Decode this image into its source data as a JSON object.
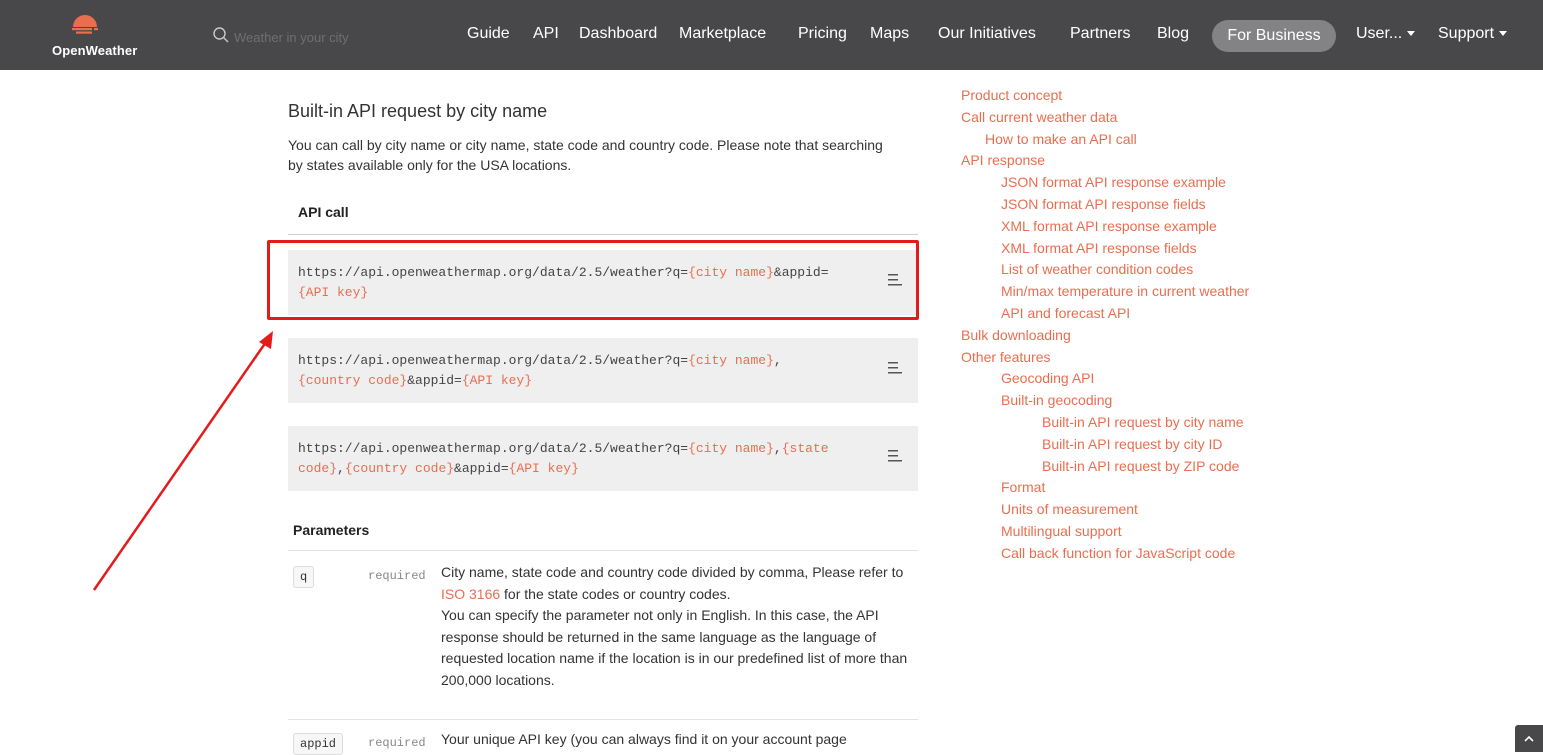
{
  "brand": {
    "name": "OpenWeather",
    "accent": "#e96e50",
    "topbar_bg": "#48484a"
  },
  "search": {
    "placeholder": "Weather in your city"
  },
  "nav": {
    "items": [
      "Guide",
      "API",
      "Dashboard",
      "Marketplace",
      "Pricing",
      "Maps",
      "Our Initiatives",
      "Partners",
      "Blog"
    ],
    "for_business": "For Business",
    "user": "User...",
    "support": "Support"
  },
  "content": {
    "title": "Built-in API request by city name",
    "intro": "You can call by city name or city name, state code and country code. Please note that searching by states available only for the USA locations.",
    "api_call_heading": "API call",
    "code_blocks": [
      [
        {
          "t": "https://api.openweathermap.org/data/2.5/weather?q=",
          "ph": false
        },
        {
          "t": "{city name}",
          "ph": true
        },
        {
          "t": "&appid=",
          "ph": false
        },
        {
          "t": "{API key}",
          "ph": true
        }
      ],
      [
        {
          "t": "https://api.openweathermap.org/data/2.5/weather?q=",
          "ph": false
        },
        {
          "t": "{city name}",
          "ph": true
        },
        {
          "t": ",",
          "ph": false
        },
        {
          "t": "{country code}",
          "ph": true
        },
        {
          "t": "&appid=",
          "ph": false
        },
        {
          "t": "{API key}",
          "ph": true
        }
      ],
      [
        {
          "t": "https://api.openweathermap.org/data/2.5/weather?q=",
          "ph": false
        },
        {
          "t": "{city name}",
          "ph": true
        },
        {
          "t": ",",
          "ph": false
        },
        {
          "t": "{state code}",
          "ph": true
        },
        {
          "t": ",",
          "ph": false
        },
        {
          "t": "{country code}",
          "ph": true
        },
        {
          "t": "&appid=",
          "ph": false
        },
        {
          "t": "{API key}",
          "ph": true
        }
      ]
    ],
    "params_heading": "Parameters",
    "params": [
      {
        "name": "q",
        "req": "required",
        "desc_before": "City name, state code and country code divided by comma, Please refer to ",
        "link": "ISO 3166",
        "desc_after": " for the state codes or country codes.",
        "desc_2": "You can specify the parameter not only in English. In this case, the API response should be returned in the same language as the language of requested location name if the location is in our predefined list of more than 200,000 locations."
      },
      {
        "name": "appid",
        "req": "required",
        "desc_before": "Your unique API key (you can always find it on your account page",
        "link": "",
        "desc_after": "",
        "desc_2": ""
      }
    ]
  },
  "toc": [
    {
      "label": "Product concept",
      "level": 0
    },
    {
      "label": "Call current weather data",
      "level": 0
    },
    {
      "label": "How to make an API call",
      "level": 1
    },
    {
      "label": "API response",
      "level": 0
    },
    {
      "label": "JSON format API response example",
      "level": 2
    },
    {
      "label": "JSON format API response fields",
      "level": 2
    },
    {
      "label": "XML format API response example",
      "level": 2
    },
    {
      "label": "XML format API response fields",
      "level": 2
    },
    {
      "label": "List of weather condition codes",
      "level": 2
    },
    {
      "label": "Min/max temperature in current weather",
      "level": 2
    },
    {
      "label": "API and forecast API",
      "level": 2
    },
    {
      "label": "Bulk downloading",
      "level": 0
    },
    {
      "label": "Other features",
      "level": 0
    },
    {
      "label": "Geocoding API",
      "level": 2
    },
    {
      "label": "Built-in geocoding",
      "level": 2
    },
    {
      "label": "Built-in API request by city name",
      "level": 3
    },
    {
      "label": "Built-in API request by city ID",
      "level": 3
    },
    {
      "label": "Built-in API request by ZIP code",
      "level": 3
    },
    {
      "label": "Format",
      "level": 2
    },
    {
      "label": "Units of measurement",
      "level": 2
    },
    {
      "label": "Multilingual support",
      "level": 2
    },
    {
      "label": "Call back function for JavaScript code",
      "level": 2
    }
  ],
  "annotation": {
    "color": "#e31b1b"
  }
}
